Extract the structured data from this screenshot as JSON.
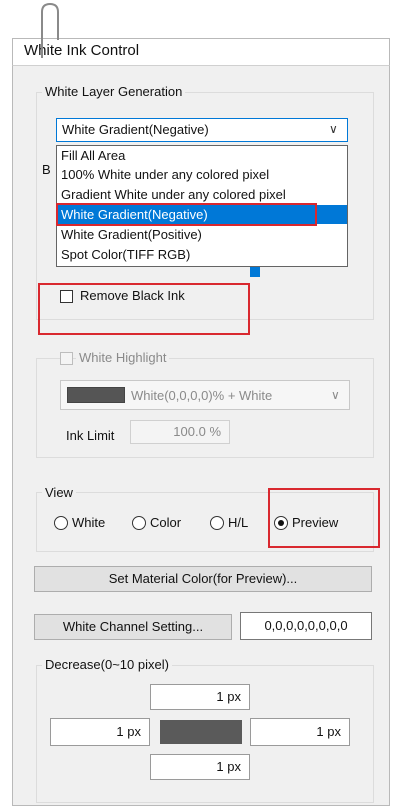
{
  "window": {
    "title": "White Ink Control"
  },
  "white_layer": {
    "group_label": "White Layer Generation",
    "selected": "White Gradient(Negative)",
    "options": [
      "Fill All Area",
      "100% White under any colored pixel",
      "Gradient White under any colored pixel",
      "White Gradient(Negative)",
      "White Gradient(Positive)",
      "Spot Color(TIFF RGB)"
    ],
    "hidden_group_label_start": "B"
  },
  "remove_black_ink": {
    "label": "Remove Black Ink",
    "checked": false
  },
  "white_highlight": {
    "label": "White Highlight",
    "checked": false,
    "swatch_color": "#555555",
    "selected": "White(0,0,0,0)% + White",
    "ink_limit_label": "Ink Limit",
    "ink_limit_value": "100.0 %"
  },
  "view": {
    "group_label": "View",
    "options": [
      {
        "label": "White",
        "checked": false
      },
      {
        "label": "Color",
        "checked": false
      },
      {
        "label": "H/L",
        "checked": false
      },
      {
        "label": "Preview",
        "checked": true
      }
    ]
  },
  "buttons": {
    "set_material_color": "Set Material Color(for Preview)...",
    "white_channel_setting": "White Channel Setting..."
  },
  "white_channel_value": "0,0,0,0,0,0,0,0",
  "decrease": {
    "group_label": "Decrease(0~10 pixel)",
    "top": "1 px",
    "left": "1 px",
    "right": "1 px",
    "bottom": "1 px",
    "center_color": "#5a5a5a"
  },
  "colors": {
    "accent": "#0078d7",
    "highlight_box": "#d9282f"
  }
}
